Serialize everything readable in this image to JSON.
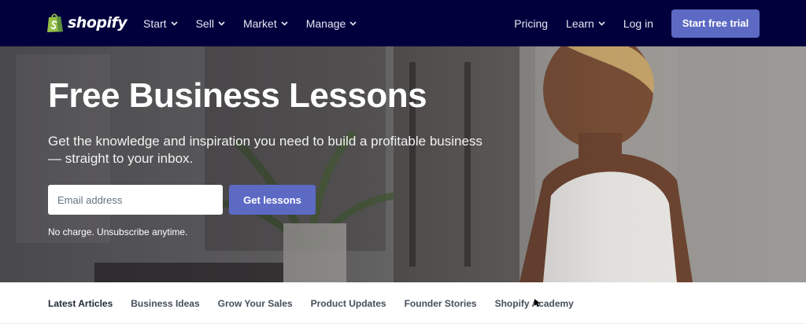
{
  "brand": {
    "name": "shopify",
    "accent": "#5c6ac4",
    "nav_bg": "#01003d",
    "logo_icon": "shopping-bag-icon"
  },
  "topnav": {
    "left_items": [
      {
        "label": "Start"
      },
      {
        "label": "Sell"
      },
      {
        "label": "Market"
      },
      {
        "label": "Manage"
      }
    ],
    "pricing": "Pricing",
    "learn": "Learn",
    "login": "Log in",
    "cta": "Start free trial"
  },
  "hero": {
    "title": "Free Business Lessons",
    "subtitle": "Get the knowledge and inspiration you need to build a profitable business — straight to your inbox.",
    "email_placeholder": "Email address",
    "button": "Get lessons",
    "note": "No charge. Unsubscribe anytime."
  },
  "subnav": {
    "items": [
      {
        "label": "Latest Articles"
      },
      {
        "label": "Business Ideas"
      },
      {
        "label": "Grow Your Sales"
      },
      {
        "label": "Product Updates"
      },
      {
        "label": "Founder Stories"
      },
      {
        "label": "Shopify Academy"
      }
    ]
  }
}
